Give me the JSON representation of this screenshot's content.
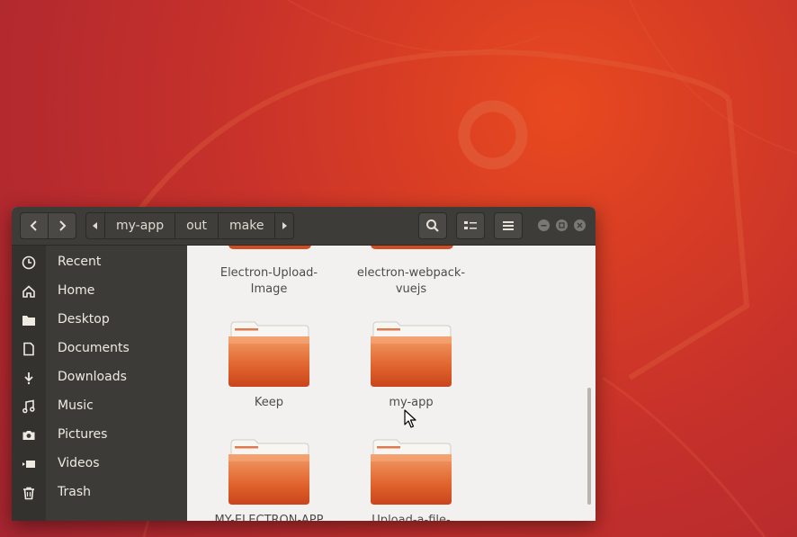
{
  "window": {
    "nav": {
      "back_icon": "chevron-left-icon",
      "forward_icon": "chevron-right-icon"
    },
    "pathbar": {
      "crumbs": [
        "my-app",
        "out",
        "make"
      ]
    },
    "toolbar": {
      "search_icon": "search-icon",
      "view_icon": "view-options-icon",
      "menu_icon": "hamburger-menu-icon"
    }
  },
  "sidebar": {
    "items": [
      {
        "label": "Recent",
        "icon": "clock-icon"
      },
      {
        "label": "Home",
        "icon": "home-icon"
      },
      {
        "label": "Desktop",
        "icon": "folder-icon"
      },
      {
        "label": "Documents",
        "icon": "document-icon"
      },
      {
        "label": "Downloads",
        "icon": "download-icon"
      },
      {
        "label": "Music",
        "icon": "music-icon"
      },
      {
        "label": "Pictures",
        "icon": "camera-icon"
      },
      {
        "label": "Videos",
        "icon": "video-icon"
      },
      {
        "label": "Trash",
        "icon": "trash-icon"
      }
    ]
  },
  "files": [
    {
      "line1": "Electron-Upload-",
      "line2": "Image"
    },
    {
      "line1": "electron-webpack-",
      "line2": "vuejs"
    },
    {
      "line1": "Keep",
      "line2": ""
    },
    {
      "line1": "my-app",
      "line2": ""
    },
    {
      "line1": "MY-ELECTRON-APP",
      "line2": ""
    },
    {
      "line1": "Upload-a-file-",
      "line2": ""
    }
  ],
  "colors": {
    "accent": "#e05a28",
    "folder_dark": "#c9441b",
    "sidebar_bg": "#3c3b37"
  }
}
